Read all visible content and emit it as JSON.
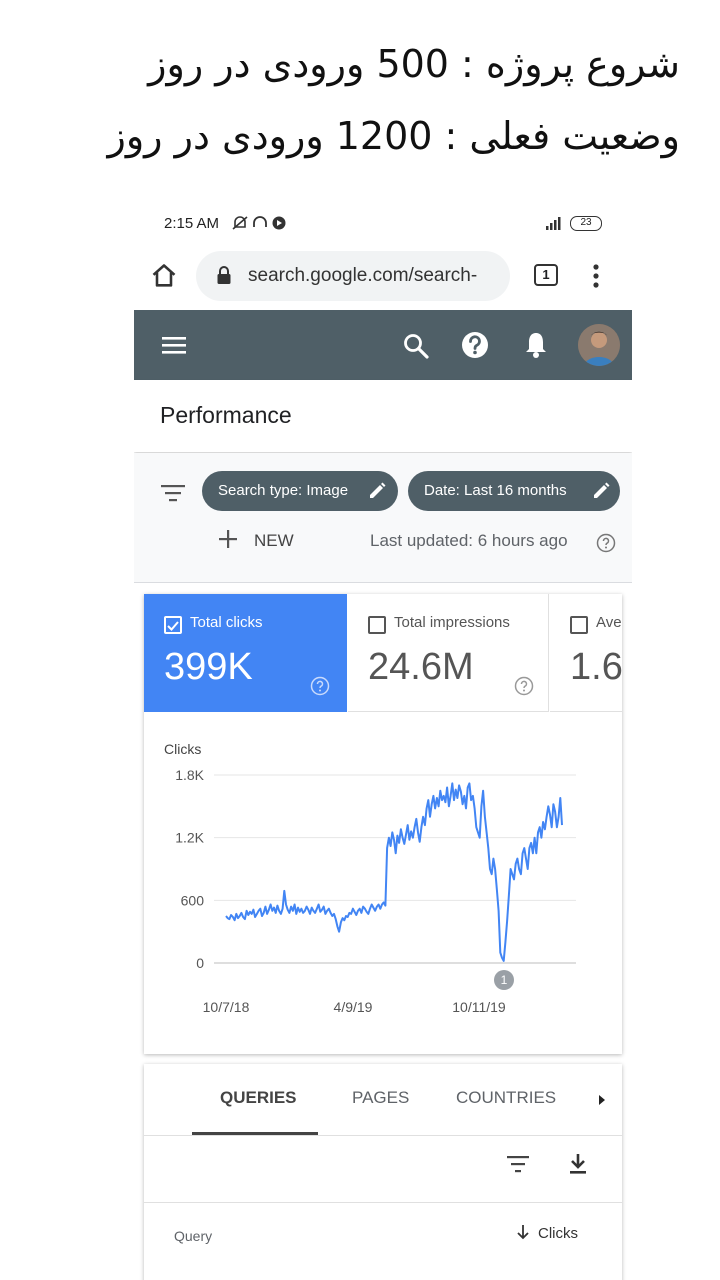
{
  "caption": {
    "line1": "شروع پروژه : 500 ورودی در روز",
    "line2": "وضعیت فعلی : 1200 ورودی در روز"
  },
  "status_bar": {
    "time": "2:15 AM",
    "battery": "23"
  },
  "browser": {
    "url": "search.google.com/search-",
    "tab_count": "1"
  },
  "app": {
    "page_title": "Performance"
  },
  "filters": {
    "chip_search_type": "Search type: Image",
    "chip_date": "Date: Last 16 months",
    "new_label": "NEW",
    "last_updated": "Last updated: 6 hours ago"
  },
  "metrics": [
    {
      "label": "Total clicks",
      "value": "399K",
      "checked": true
    },
    {
      "label": "Total impressions",
      "value": "24.6M",
      "checked": false
    },
    {
      "label": "Ave",
      "value": "1.6",
      "checked": false
    }
  ],
  "chart_data": {
    "type": "line",
    "ylabel": "Clicks",
    "y_ticks": [
      "1.8K",
      "1.2K",
      "600",
      "0"
    ],
    "ylim": [
      0,
      1800
    ],
    "x_ticks": [
      "10/7/18",
      "4/9/19",
      "10/11/19"
    ],
    "annotation": "1",
    "grid": true,
    "series": [
      {
        "values": [
          450,
          430,
          420,
          460,
          440,
          410,
          470,
          430,
          450,
          480,
          440,
          420,
          500,
          460,
          490,
          470,
          510,
          440,
          470,
          500,
          520,
          450,
          480,
          540,
          470,
          510,
          560,
          500,
          530,
          480,
          550,
          500,
          470,
          520,
          690,
          560,
          510,
          480,
          540,
          500,
          560,
          470,
          530,
          490,
          520,
          480,
          500,
          540,
          510,
          470,
          530,
          500,
          480,
          520,
          560,
          490,
          510,
          540,
          470,
          500,
          520,
          480,
          450,
          470,
          420,
          350,
          300,
          390,
          430,
          410,
          450,
          440,
          480,
          470,
          520,
          490,
          460,
          500,
          520,
          480,
          540,
          520,
          490,
          470,
          520,
          560,
          530,
          500,
          540,
          560,
          520,
          560,
          580,
          550,
          1100,
          1200,
          1120,
          1250,
          1180,
          1050,
          1220,
          1150,
          1280,
          1200,
          1140,
          1230,
          1320,
          1180,
          1260,
          1200,
          1300,
          1380,
          1250,
          1160,
          1300,
          1400,
          1320,
          1480,
          1560,
          1400,
          1520,
          1600,
          1480,
          1580,
          1500,
          1650,
          1560,
          1600,
          1540,
          1680,
          1500,
          1600,
          1720,
          1560,
          1660,
          1580,
          1700,
          1640,
          1520,
          1600,
          1480,
          1680,
          1720,
          1560,
          1600,
          1480,
          1300,
          1250,
          1200,
          1500,
          1650,
          1400,
          1250,
          1100,
          900,
          850,
          1000,
          900,
          700,
          500,
          100,
          50,
          20,
          200,
          400,
          650,
          900,
          850,
          800,
          950,
          1000,
          900,
          850,
          1050,
          1100,
          1000,
          900,
          1100,
          1150,
          1050,
          1200,
          1050,
          1250,
          1300,
          1200,
          1350,
          1280,
          1400,
          1500,
          1420,
          1300,
          1520,
          1450,
          1300,
          1400,
          1580,
          1320
        ]
      }
    ]
  },
  "tabs": {
    "queries": "QUERIES",
    "pages": "PAGES",
    "countries": "COUNTRIES"
  },
  "table": {
    "col_query": "Query",
    "col_clicks": "Clicks"
  },
  "colors": {
    "appbar": "#4f5f67",
    "accent": "#4285f4",
    "line": "#4285f4"
  }
}
